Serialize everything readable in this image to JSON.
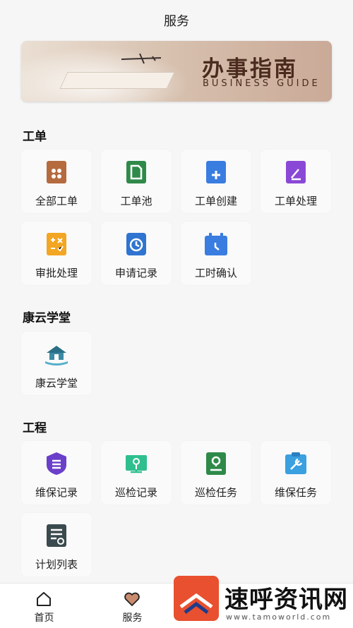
{
  "header": {
    "title": "服务"
  },
  "banner": {
    "title_cn": "办事指南",
    "title_en": "BUSINESS GUIDE"
  },
  "sections": [
    {
      "title": "工单",
      "items": [
        {
          "label": "全部工单",
          "icon": "all-orders-icon",
          "color": "#b56b3e"
        },
        {
          "label": "工单池",
          "icon": "order-pool-icon",
          "color": "#2f8a4a"
        },
        {
          "label": "工单创建",
          "icon": "create-order-icon",
          "color": "#3a7de0"
        },
        {
          "label": "工单处理",
          "icon": "handle-order-icon",
          "color": "#8a48d6"
        },
        {
          "label": "审批处理",
          "icon": "approval-icon",
          "color": "#f2a623"
        },
        {
          "label": "申请记录",
          "icon": "application-record-icon",
          "color": "#2f74d0"
        },
        {
          "label": "工时确认",
          "icon": "work-hours-icon",
          "color": "#3a7de0"
        }
      ]
    },
    {
      "title": "康云学堂",
      "items": [
        {
          "label": "康云学堂",
          "icon": "school-icon",
          "color": "#2a6f86"
        }
      ]
    },
    {
      "title": "工程",
      "items": [
        {
          "label": "维保记录",
          "icon": "maintenance-record-icon",
          "color": "#6a3fc9"
        },
        {
          "label": "巡检记录",
          "icon": "inspection-record-icon",
          "color": "#2fbf8f"
        },
        {
          "label": "巡检任务",
          "icon": "inspection-task-icon",
          "color": "#2f8a4a"
        },
        {
          "label": "维保任务",
          "icon": "maintenance-task-icon",
          "color": "#3aa0e0"
        },
        {
          "label": "计划列表",
          "icon": "plan-list-icon",
          "color": "#3a4a4f"
        }
      ]
    }
  ],
  "tabbar": [
    {
      "label": "首页",
      "icon": "home-icon"
    },
    {
      "label": "服务",
      "icon": "heart-icon",
      "active": true
    },
    {
      "label": "",
      "icon": ""
    },
    {
      "label": "",
      "icon": ""
    }
  ],
  "watermark": {
    "text": "速呼资讯网",
    "sub": "www.tamoworld.com"
  }
}
